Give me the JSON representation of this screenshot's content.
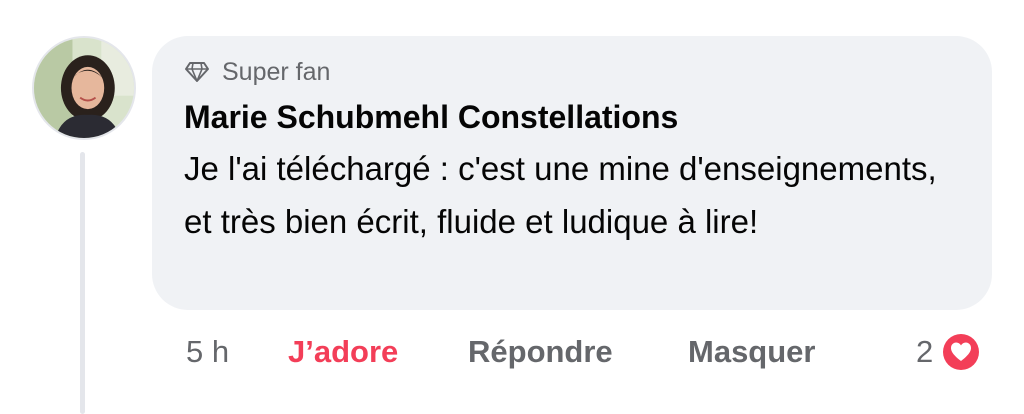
{
  "comment": {
    "badge": {
      "icon": "diamond-icon",
      "label": "Super fan"
    },
    "author": "Marie Schubmehl Constellations",
    "text": "Je l'ai téléchargé : c'est une mine d'enseignements, et très bien écrit, fluide et ludique à lire!",
    "avatar_icon": "profile-photo"
  },
  "actions": {
    "time": "5 h",
    "love_label": "J’adore",
    "reply_label": "Répondre",
    "hide_label": "Masquer"
  },
  "reactions": {
    "count": "2",
    "icon": "heart-reaction-icon"
  },
  "colors": {
    "bubble": "#f0f2f5",
    "love": "#f33e58",
    "secondary_text": "#65676b",
    "primary_text": "#050505"
  }
}
